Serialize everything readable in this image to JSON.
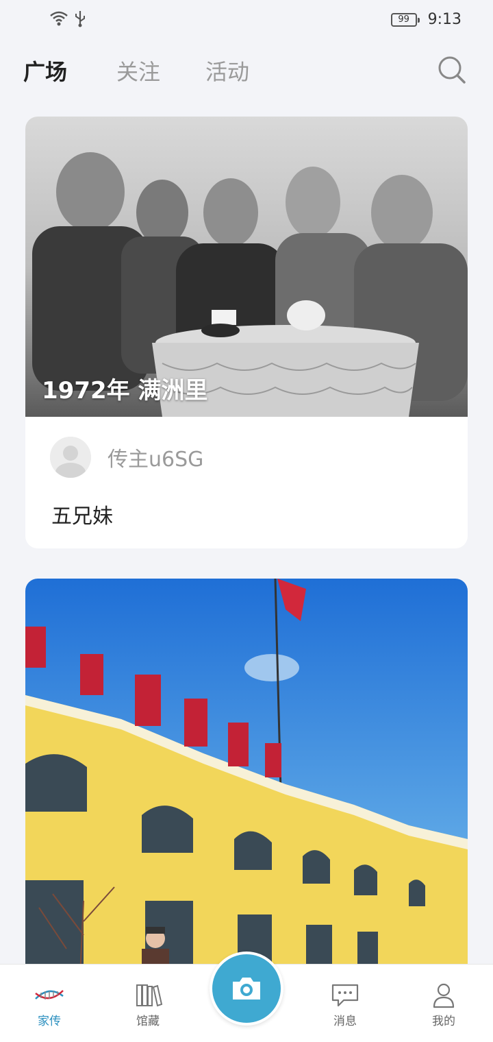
{
  "status_bar": {
    "battery": "99",
    "time": "9:13",
    "icons": [
      "wifi-icon",
      "usb-icon"
    ]
  },
  "top_nav": {
    "tabs": [
      {
        "label": "广场",
        "active": true
      },
      {
        "label": "关注",
        "active": false
      },
      {
        "label": "活动",
        "active": false
      }
    ],
    "search_icon": "search-icon"
  },
  "feed": [
    {
      "caption": "1972年  满洲里",
      "author": "传主u6SG",
      "title": "五兄妹"
    },
    {
      "caption": ""
    }
  ],
  "bottom_nav": {
    "items": [
      {
        "label": "家传",
        "icon": "dna-icon",
        "active": true
      },
      {
        "label": "馆藏",
        "icon": "books-icon",
        "active": false
      },
      {
        "label": "消息",
        "icon": "chat-icon",
        "active": false
      },
      {
        "label": "我的",
        "icon": "user-icon",
        "active": false
      }
    ],
    "camera_icon": "camera-icon"
  },
  "colors": {
    "accent": "#3fa9d1",
    "active_label": "#2a8fbf",
    "background": "#f3f4f8"
  }
}
